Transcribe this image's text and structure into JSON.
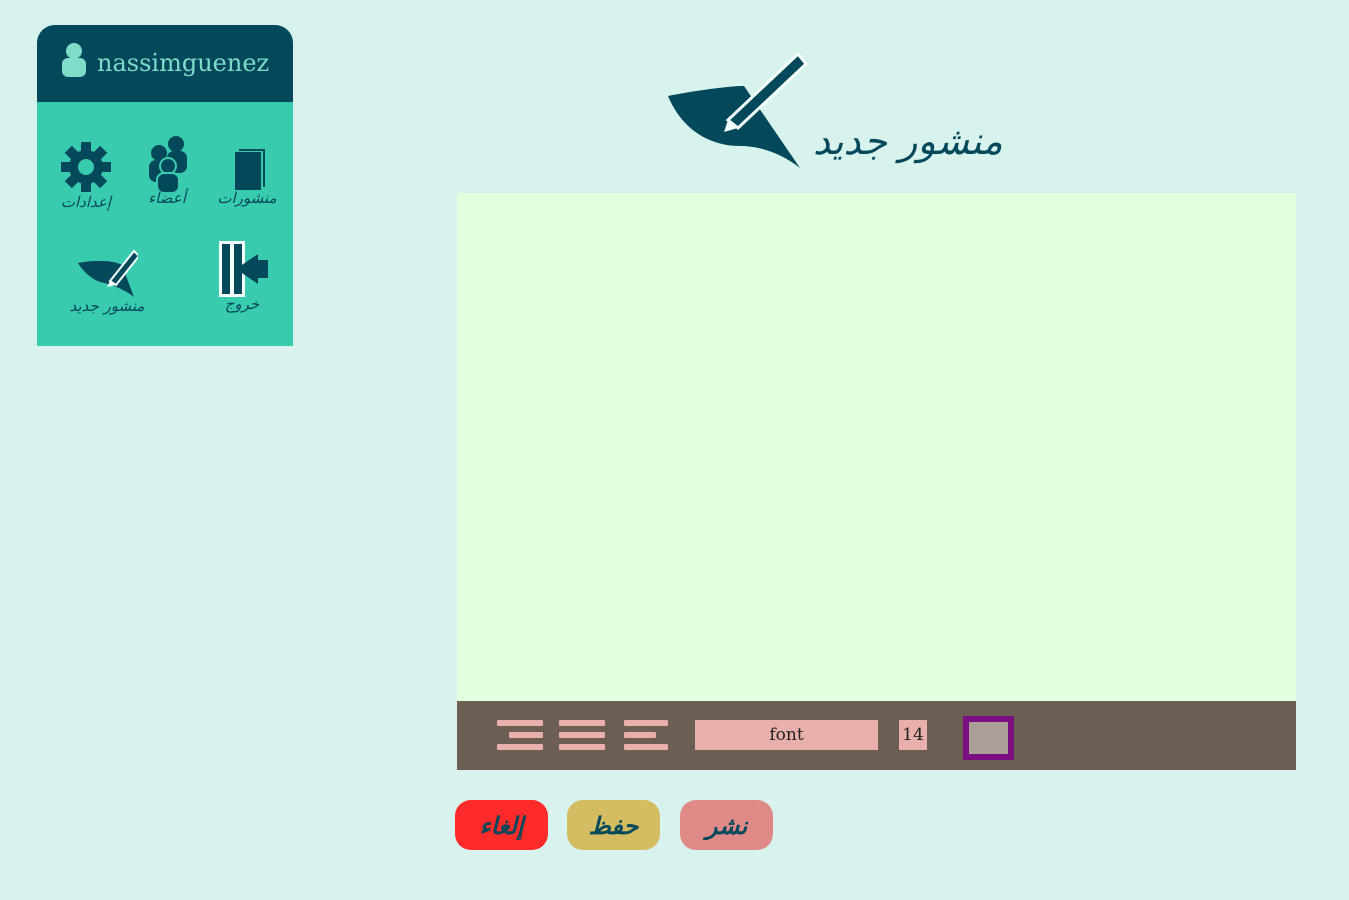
{
  "sidebar": {
    "username": "nassimguenez",
    "items": [
      {
        "id": "posts",
        "label": "منشورات",
        "icon": "documents-icon"
      },
      {
        "id": "members",
        "label": "أعضاء",
        "icon": "users-icon"
      },
      {
        "id": "settings",
        "label": "إعدادات",
        "icon": "gear-icon"
      },
      {
        "id": "logout",
        "label": "خروج",
        "icon": "exit-icon"
      },
      {
        "id": "new-post",
        "label": "منشور جديد",
        "icon": "pen-icon"
      }
    ]
  },
  "main": {
    "title": "منشور جديد",
    "title_icon": "pen-icon",
    "editor": {
      "value": "",
      "toolbar": {
        "align_buttons": [
          "align-right-icon",
          "align-center-icon",
          "align-left-icon"
        ],
        "font": "font",
        "size": "14",
        "color": "#a99e98"
      }
    }
  },
  "actions": {
    "publish": "نشر",
    "save": "حفظ",
    "cancel": "إلغاء"
  },
  "colors": {
    "background": "#d8f3ee",
    "panel": "#38cbad",
    "panel_header": "#03495b",
    "editor_bg": "#e2ffde",
    "toolbar_bg": "#6c5e52",
    "accent_pink": "#e8afab",
    "publish_button": "#e08a88",
    "save_button": "#d4bc60",
    "cancel_button": "#ff2a2a"
  }
}
